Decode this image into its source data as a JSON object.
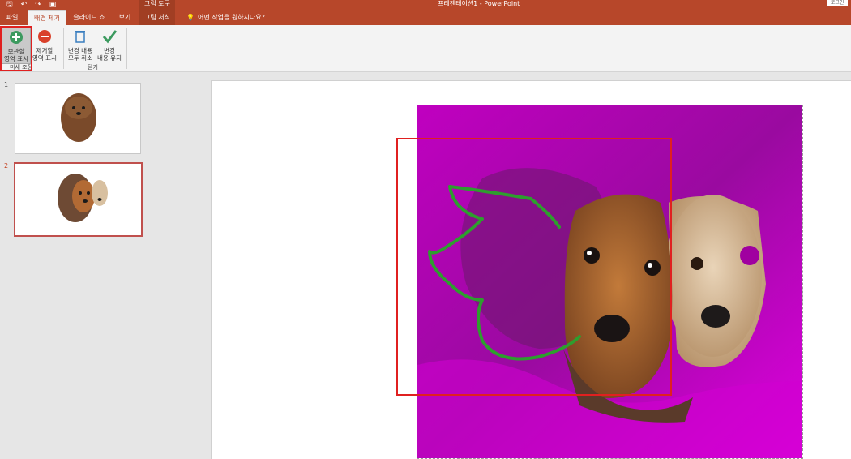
{
  "titlebar": {
    "context_tool_group": "그림 도구",
    "document_title": "프레젠테이션1 - PowerPoint",
    "sign_in": "로그인"
  },
  "tabs": [
    {
      "label": "파일"
    },
    {
      "label": "배경 제거"
    },
    {
      "label": "슬라이드 쇼"
    },
    {
      "label": "보기"
    },
    {
      "label": "그림 서식"
    }
  ],
  "tell_me": "어떤 작업을 원하시나요?",
  "ribbon": {
    "mark_keep": "보관할\n영역 표시",
    "mark_remove": "제거할\n영역 표시",
    "group_refine": "미세 조정",
    "discard_all": "변경 내용\n모두 취소",
    "keep_changes": "변경\n내용 유지",
    "group_close": "닫기"
  },
  "slides": [
    {
      "number": "1"
    },
    {
      "number": "2"
    }
  ],
  "colors": {
    "accent": "#b7472a",
    "highlight": "#e02020",
    "removal_overlay": "#cc00cc",
    "keep_stroke": "#2e9e2e"
  }
}
